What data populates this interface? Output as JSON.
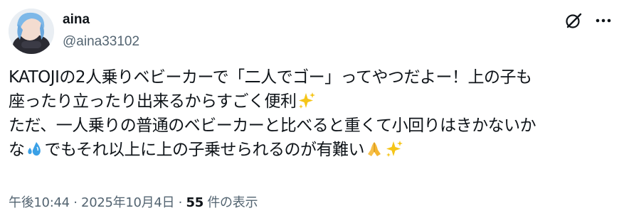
{
  "author": {
    "display_name": "aina",
    "handle": "@aina33102"
  },
  "icons": {
    "avatar": "avatar-image",
    "grok": "grok-icon",
    "more": "more-icon"
  },
  "tweet": {
    "line1": "KATOJIの2人乗りベビーカーで「二人でゴー」ってやつだよー！上の子も",
    "line2": "座ったり立ったり出来るからすごく便利",
    "line3": "ただ、一人乗りの普通のベビーカーと比べると重くて小回りはきかないか",
    "line4_prefix": "な",
    "line4_main": "でもそれ以上に上の子乗せられるのが有難い",
    "emojis": [
      "sparkles",
      "sweat-droplets",
      "folded-hands",
      "sparkles"
    ]
  },
  "meta": {
    "time": "午後10:44",
    "separator1": "·",
    "date": "2025年10月4日",
    "separator2": "·",
    "view_count": "55",
    "view_label": "件の表示"
  },
  "colors": {
    "text": "#0f1419",
    "secondary": "#536471",
    "sparkle": "#f5c518",
    "droplet": "#3aa0e6",
    "hands": "#f7c04a"
  }
}
